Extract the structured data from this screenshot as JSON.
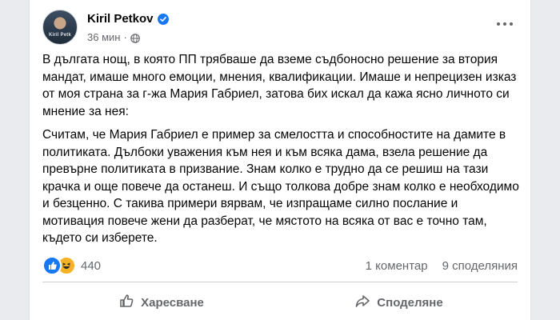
{
  "post": {
    "author": "Kiril Petkov",
    "avatar_caption": "Kiril Petk",
    "timestamp": "36 мин",
    "separator": "·",
    "paragraphs": [
      "В дългата нощ, в която ПП трябваше да вземе съдбоносно решение за втория мандат, имаше много емоции, мнения, квалификации. Имаше и непрецизен изказ от моя страна за г-жа Мария Габриел, затова бих искал да кажа ясно личното си мнение за нея:",
      "Считам, че Мария Габриел е пример за смелостта и способностите на дамите в политиката. Дълбоки уважения към нея и към всяка дама, взела решение да превърне политиката в призвание. Знам колко е трудно да се решиш на тази крачка и още повече да останеш. И също толкова добре знам колко е необходимо и безценно. С такива примери вярвам, че изпращаме силно послание и мотивация повече жени да разберат, че мястото на всяка от вас е точно там, където си изберете."
    ]
  },
  "stats": {
    "reaction_count": "440",
    "comments": "1 коментар",
    "shares": "9 споделяния"
  },
  "actions": {
    "like_label": "Харесване",
    "share_label": "Споделяне"
  },
  "colors": {
    "accent": "#1877f2",
    "haha": "#f7b125",
    "muted_text": "#65676b"
  },
  "icons": [
    "verified-badge-icon",
    "globe-icon",
    "more-options-icon",
    "like-reaction-icon",
    "haha-reaction-icon",
    "thumbs-up-icon",
    "share-arrow-icon"
  ]
}
